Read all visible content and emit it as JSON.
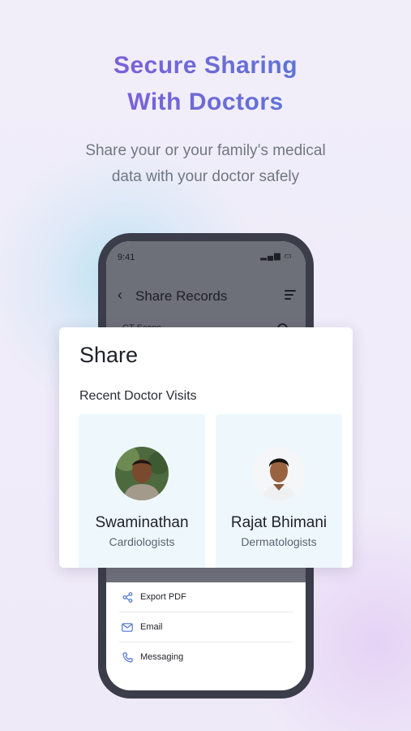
{
  "header": {
    "title_line1": "Secure Sharing",
    "title_line2": "With Doctors",
    "subtitle_line1": "Share your or your family’s medical",
    "subtitle_line2": "data with your doctor safely"
  },
  "phone": {
    "status_time": "9:41",
    "title": "Share Records",
    "search_label": "CT Scans",
    "options": [
      {
        "label": "Export PDF",
        "icon": "share-icon"
      },
      {
        "label": "Email",
        "icon": "email-icon"
      },
      {
        "label": "Messaging",
        "icon": "phone-icon"
      }
    ]
  },
  "share_card": {
    "title": "Share",
    "section_label": "Recent Doctor Visits",
    "doctors": [
      {
        "name": "Swaminathan",
        "specialty": "Cardiologists"
      },
      {
        "name": "Rajat Bhimani",
        "specialty": "Dermatologists"
      }
    ]
  },
  "colors": {
    "title_gradient_start": "#8a55d8",
    "title_gradient_end": "#4f7fd6",
    "accent_blue": "#4f73d6",
    "card_tile": "#eef8fc"
  }
}
